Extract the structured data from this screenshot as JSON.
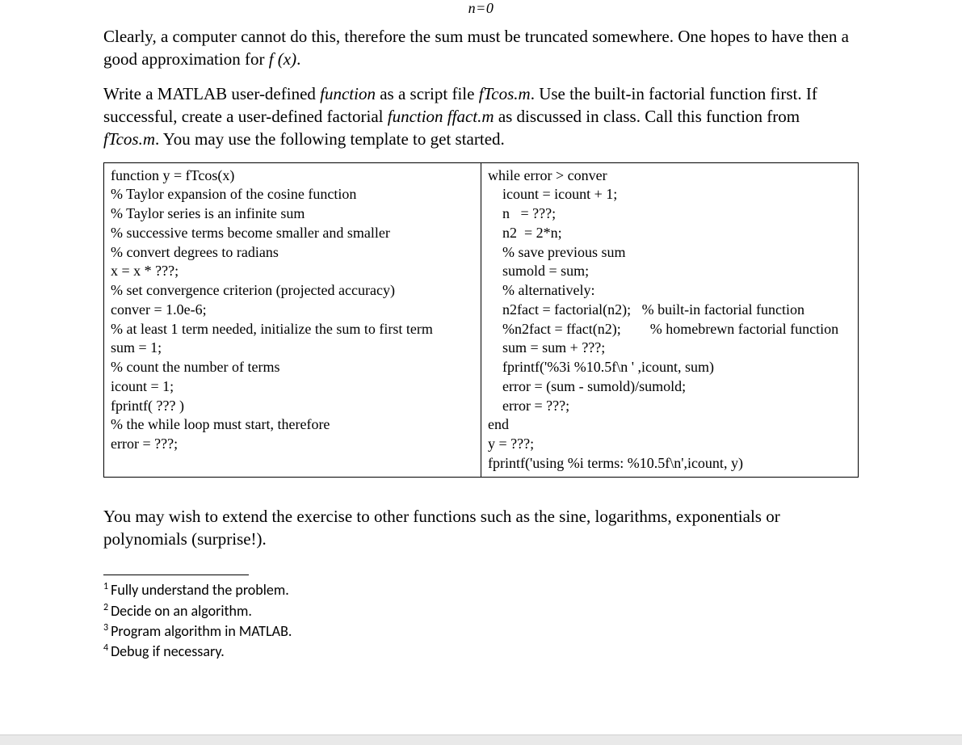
{
  "eqn_fragment": "n=0",
  "para1_a": "Clearly, a computer cannot do this, therefore the sum must be truncated somewhere. One hopes to have then a good approximation for ",
  "para1_fx": "f (x)",
  "para1_b": ".",
  "para2_a": "Write a MATLAB user-defined ",
  "para2_function1": "function",
  "para2_b": " as a script file ",
  "para2_ftcos": "fTcos.m",
  "para2_c": ". Use the built-in factorial function first. If successful, create a user-defined factorial ",
  "para2_function2": "function ffact.m",
  "para2_d": " as discussed in class. Call this function from ",
  "para2_ftcos2": "fTcos.m",
  "para2_e": ". You may use the following template to get started.",
  "code_left": "function y = fTcos(x)\n% Taylor expansion of the cosine function\n% Taylor series is an infinite sum\n% successive terms become smaller and smaller\n% convert degrees to radians\nx = x * ???;\n% set convergence criterion (projected accuracy)\nconver = 1.0e-6;\n% at least 1 term needed, initialize the sum to first term\nsum = 1;\n% count the number of terms\nicount = 1;\nfprintf( ??? )\n% the while loop must start, therefore\nerror = ???;",
  "code_right": "while error > conver\n    icount = icount + 1;\n    n   = ???;\n    n2  = 2*n;\n    % save previous sum\n    sumold = sum;\n    % alternatively:\n    n2fact = factorial(n2);   % built-in factorial function\n    %n2fact = ffact(n2);        % homebrewn factorial function\n    sum = sum + ???;\n    fprintf('%3i %10.5f\\n ' ,icount, sum)\n    error = (sum - sumold)/sumold;\n    error = ???;\nend\ny = ???;\nfprintf('using %i terms: %10.5f\\n',icount, y)",
  "para3": "You may wish to extend the exercise to other functions such as the sine, logarithms, exponentials or polynomials (surprise!).",
  "footnotes": [
    "Fully understand the problem.",
    "Decide on an algorithm.",
    "Program algorithm in MATLAB.",
    "Debug if necessary."
  ]
}
